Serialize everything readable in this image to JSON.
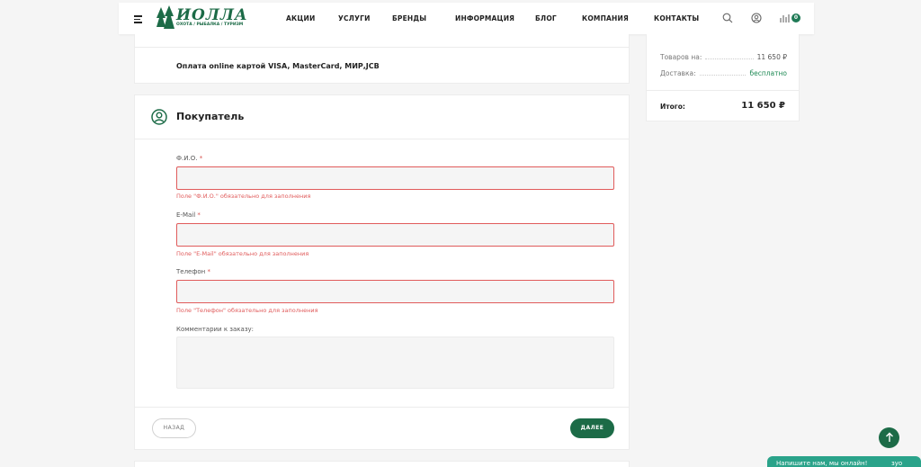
{
  "header": {
    "logo_text": "ИОЛЛА",
    "logo_sub": "ОХОТА / РЫБАЛКА / ТУРИЗМ",
    "nav": [
      "АКЦИИ",
      "УСЛУГИ",
      "БРЕНДЫ",
      "ИНФОРМАЦИЯ",
      "БЛОГ",
      "КОМПАНИЯ",
      "КОНТАКТЫ"
    ],
    "cart_count": "0"
  },
  "payment": {
    "text": "Оплата online картой VISA, MasterCard, МИР,JCB"
  },
  "buyer": {
    "title": "Покупатель",
    "fio_label": "Ф.И.О.",
    "fio_error": "Поле \"Ф.И.О.\" обязательно для заполнения",
    "email_label": "E-Mail",
    "email_error": "Поле \"E-Mail\" обязательно для заполнения",
    "phone_label": "Телефон",
    "phone_error": "Поле \"Телефон\" обязательно для заполнения",
    "comment_label": "Комментарии к заказу:",
    "required_mark": "*",
    "back_button": "НАЗАД",
    "next_button": "ДАЛЕЕ"
  },
  "summary": {
    "items_label": "Товаров на:",
    "items_value": "11 650 ₽",
    "delivery_label": "Доставка:",
    "delivery_value": "бесплатно",
    "total_label": "Итого:",
    "total_value": "11 650 ₽"
  },
  "chat": {
    "text": "Напишите нам, мы онлайн!",
    "end": "зуо"
  },
  "colors": {
    "accent": "#1c6b47",
    "error": "#e05b5b"
  }
}
